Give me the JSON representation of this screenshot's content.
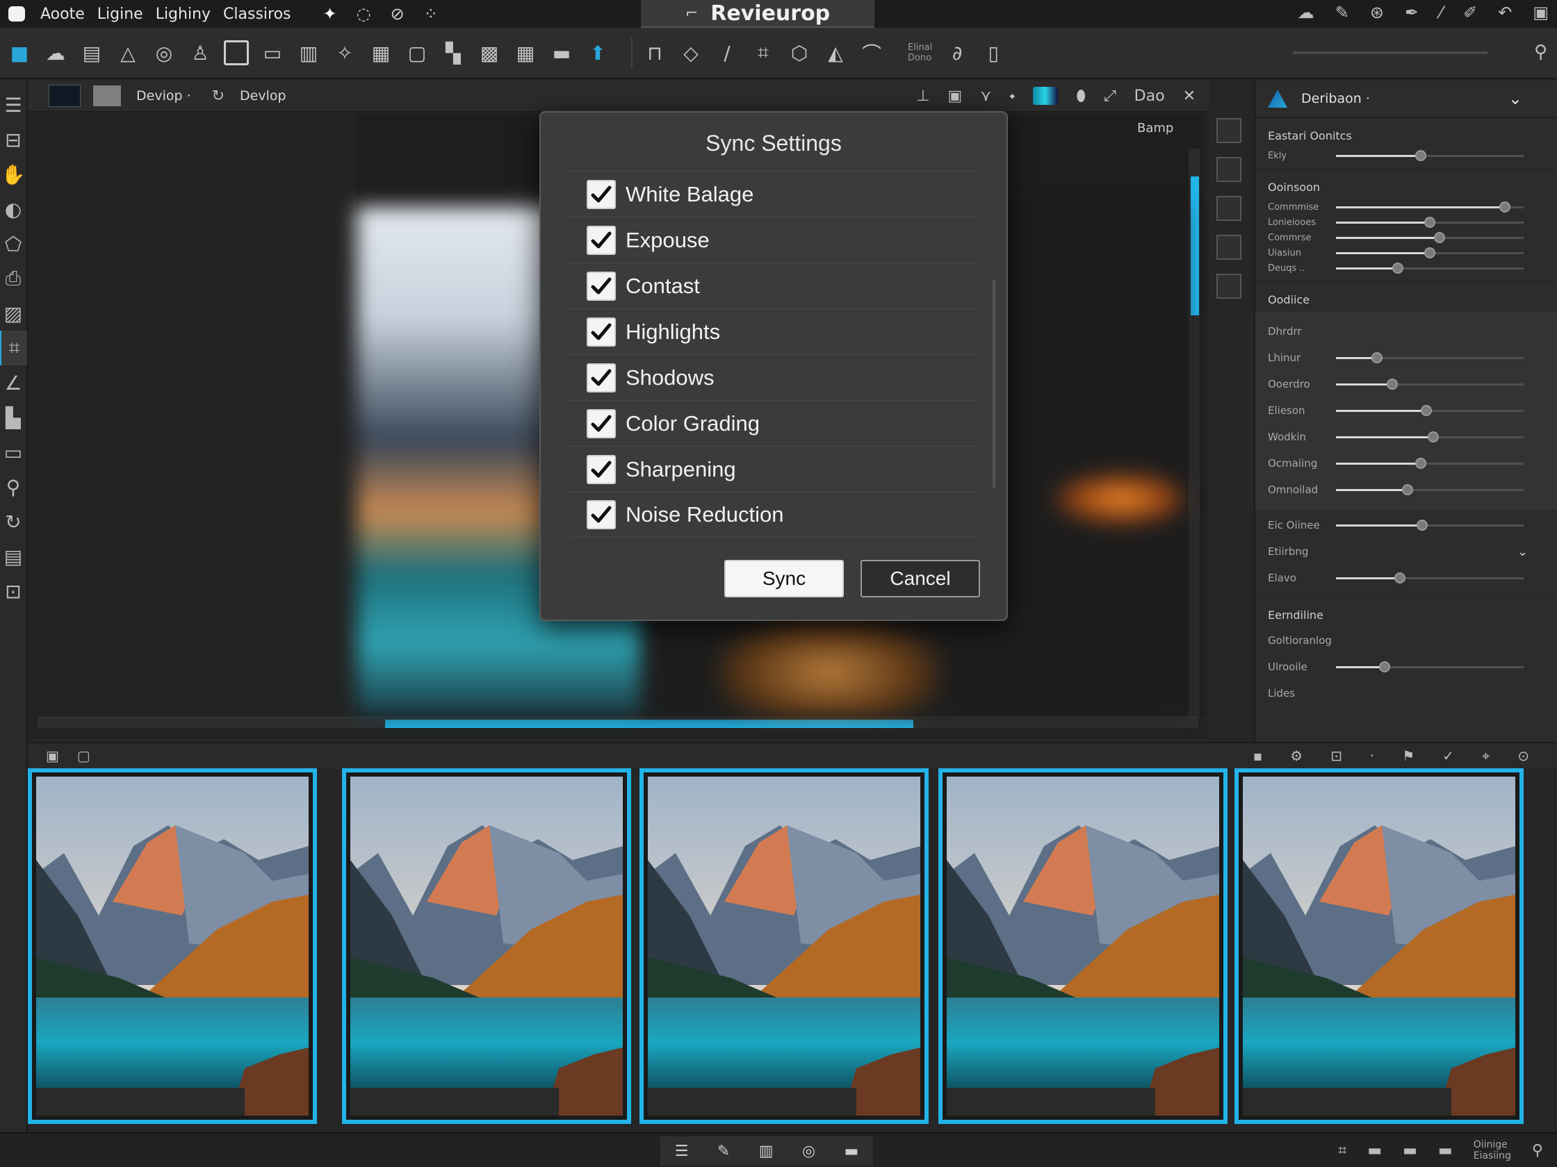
{
  "menubar": {
    "items": [
      "Aoote",
      "Ligine",
      "Lighiny",
      "Classiros"
    ],
    "document_tab": "Revieurop"
  },
  "toolbar": {
    "note_lines": [
      "Elinal",
      "Dono"
    ]
  },
  "viewer_header": {
    "module_label": "Deviop ·",
    "second_label": "Devlop",
    "right_label": "Dao"
  },
  "viewer": {
    "zoom_label": "Bamp"
  },
  "right_panel": {
    "title": "Deribaon ·",
    "sections": [
      {
        "title": "Eastari Oonitcs",
        "rows": [
          {
            "label": "Ekly",
            "value": 0.45
          }
        ]
      },
      {
        "title": "Ooinsoon",
        "rows": [
          {
            "label": "Commmise",
            "value": 0.9
          },
          {
            "label": "Lonieiooes",
            "value": 0.5
          },
          {
            "label": "Commrse",
            "value": 0.55
          },
          {
            "label": "Uiasiun",
            "value": 0.5
          },
          {
            "label": "Deuqs ..",
            "value": 0.33
          }
        ]
      },
      {
        "title": "Oodiice",
        "rows": [
          {
            "label": "Dhrdrr",
            "value": null
          },
          {
            "label": "Lhinur",
            "value": 0.22
          },
          {
            "label": "Ooerdro",
            "value": 0.3
          },
          {
            "label": "Elieson",
            "value": 0.48
          },
          {
            "label": "Wodkin",
            "value": 0.52
          },
          {
            "label": "Ocmaiing",
            "value": 0.45
          },
          {
            "label": "Omnoilad",
            "value": 0.38
          },
          {
            "label": "Eic Oiinee",
            "value": 0.46
          },
          {
            "label": "Etiirbng",
            "value": null
          },
          {
            "label": "Elavo",
            "value": 0.34
          }
        ]
      },
      {
        "title": "Eerndiline",
        "rows": [
          {
            "label": "Goltioranlog",
            "value": null
          },
          {
            "label": "Ulrooile",
            "value": 0.26
          },
          {
            "label": "Lides",
            "value": null
          }
        ]
      }
    ]
  },
  "dialog": {
    "title": "Sync Settings",
    "items": [
      {
        "label": "White Balage",
        "checked": true
      },
      {
        "label": "Expouse",
        "checked": true
      },
      {
        "label": "Contast",
        "checked": true
      },
      {
        "label": "Highlights",
        "checked": true
      },
      {
        "label": "Shodows",
        "checked": true
      },
      {
        "label": "Color Grading",
        "checked": true
      },
      {
        "label": "Sharpening",
        "checked": true
      },
      {
        "label": "Noise Reduction",
        "checked": true
      }
    ],
    "sync_label": "Sync",
    "cancel_label": "Cancel"
  },
  "filmstrip": {
    "count": 5,
    "selected_color": "#22b3e8"
  },
  "bottombar": {
    "status_lines": [
      "Oiinige",
      "Eiasiing"
    ]
  },
  "colors": {
    "accent": "#2aa7d8",
    "selection": "#22b3e8",
    "panel": "#2c2c2c",
    "dialog": "#3b3b3b"
  }
}
